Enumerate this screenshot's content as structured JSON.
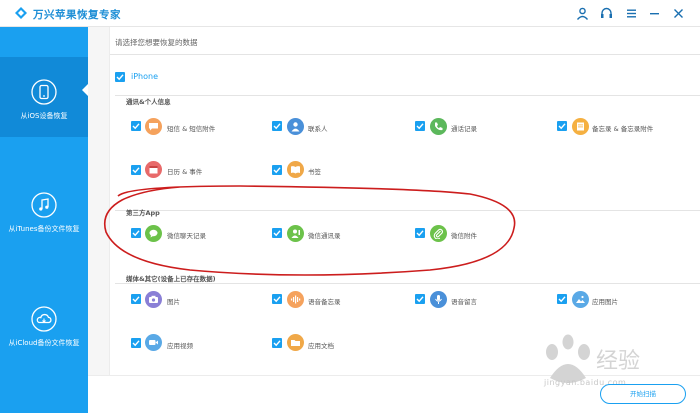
{
  "app": {
    "title": "万兴苹果恢复专家",
    "accent_color": "#1aa0f0",
    "titlebar_icons": [
      "user-icon",
      "headset-icon",
      "menu-icon",
      "minimize-icon",
      "close-icon"
    ]
  },
  "sidebar": {
    "items": [
      {
        "label": "从iOS设备恢复",
        "icon": "phone-icon",
        "active": true
      },
      {
        "label": "从iTunes备份文件恢复",
        "icon": "music-note-icon",
        "active": false
      },
      {
        "label": "从iCloud备份文件恢复",
        "icon": "cloud-icon",
        "active": false
      }
    ]
  },
  "main": {
    "prompt": "请选择您想要恢复的数据",
    "root": {
      "label": "iPhone",
      "checked": true
    },
    "sections": [
      {
        "title": "通讯&个人信息",
        "items": [
          {
            "label": "短信 & 短信附件",
            "icon": "message-icon",
            "color": "#f5a25d",
            "checked": true
          },
          {
            "label": "联系人",
            "icon": "contact-icon",
            "color": "#4a90d9",
            "checked": true
          },
          {
            "label": "通话记录",
            "icon": "phone-call-icon",
            "color": "#5cb85c",
            "checked": true
          },
          {
            "label": "备忘录 & 备忘录附件",
            "icon": "note-icon",
            "color": "#f5b041",
            "checked": true
          },
          {
            "label": "日历 & 事件",
            "icon": "calendar-icon",
            "color": "#e86a6a",
            "checked": true
          },
          {
            "label": "书签",
            "icon": "book-icon",
            "color": "#f0a848",
            "checked": true
          }
        ]
      },
      {
        "title": "第三方App",
        "items": [
          {
            "label": "微信聊天记录",
            "icon": "wechat-icon",
            "color": "#6cc24a",
            "checked": true
          },
          {
            "label": "微信通讯录",
            "icon": "wechat-contact-icon",
            "color": "#6cc24a",
            "checked": true
          },
          {
            "label": "微信附件",
            "icon": "attachment-icon",
            "color": "#6cc24a",
            "checked": true
          }
        ]
      },
      {
        "title": "媒体&其它(设备上已存在数据)",
        "items": [
          {
            "label": "图片",
            "icon": "camera-icon",
            "color": "#8a7fd6",
            "checked": true
          },
          {
            "label": "语音备忘录",
            "icon": "voice-memo-icon",
            "color": "#f5a25d",
            "checked": true
          },
          {
            "label": "语音留言",
            "icon": "microphone-icon",
            "color": "#4a90d9",
            "checked": true
          },
          {
            "label": "应用图片",
            "icon": "image-icon",
            "color": "#5aa9e6",
            "checked": true
          },
          {
            "label": "应用视频",
            "icon": "video-icon",
            "color": "#5aa9e6",
            "checked": true
          },
          {
            "label": "应用文档",
            "icon": "folder-icon",
            "color": "#f0a848",
            "checked": true
          }
        ]
      }
    ]
  },
  "footer": {
    "start_button": "开始扫描"
  },
  "watermark": {
    "text": "jingyan.baidu.com"
  }
}
